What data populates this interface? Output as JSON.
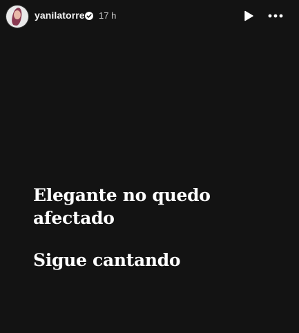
{
  "header": {
    "username": "yanilatorre",
    "verified": true,
    "time": "17 h",
    "icons": {
      "play": "play-icon",
      "more": "more-options-icon",
      "verified": "verified-badge-icon"
    }
  },
  "story": {
    "line1": "Elegante no quedo",
    "line2": "afectado",
    "line3": "Sigue cantando",
    "background": "#131313",
    "text_color": "#ffffff"
  }
}
